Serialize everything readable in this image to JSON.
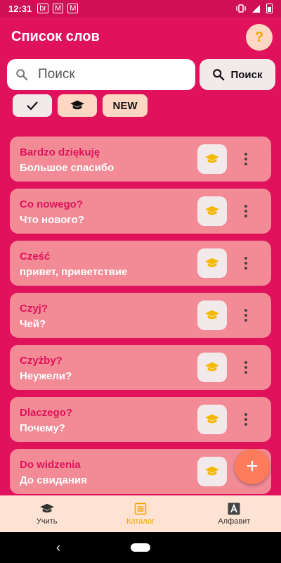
{
  "statusbar": {
    "time": "12:31",
    "notifications": [
      "br",
      "M",
      "M"
    ]
  },
  "appbar": {
    "title": "Список слов",
    "help_label": "?"
  },
  "search": {
    "placeholder": "Поиск",
    "button_label": "Поиск"
  },
  "filters": {
    "new_label": "NEW"
  },
  "words": [
    {
      "pl": "Bardzo dziękuję",
      "ru": "Большое спасибо"
    },
    {
      "pl": "Co nowego?",
      "ru": "Что нового?"
    },
    {
      "pl": "Cześć",
      "ru": "привет, приветствие"
    },
    {
      "pl": "Czyj?",
      "ru": "Чей?"
    },
    {
      "pl": "Czyżby?",
      "ru": "Неужели?"
    },
    {
      "pl": "Dlaczego?",
      "ru": "Почему?"
    },
    {
      "pl": "Do widzenia",
      "ru": "До свидания"
    }
  ],
  "fab_label": "+",
  "bottom_nav": [
    {
      "label": "Учить",
      "icon": "graduation-cap-icon"
    },
    {
      "label": "Каталог",
      "icon": "list-icon",
      "active": true
    },
    {
      "label": "Алфавит",
      "icon": "alphabet-icon"
    }
  ],
  "colors": {
    "primary": "#E0125B",
    "card": "#F28B96",
    "accent": "#F5A400",
    "fab": "#FF7B5C"
  }
}
